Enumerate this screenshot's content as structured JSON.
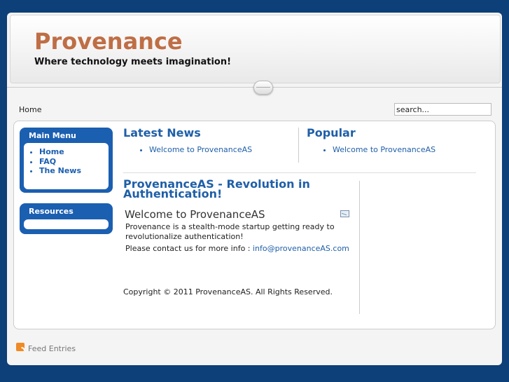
{
  "header": {
    "site_title": "Provenance",
    "slogan": "Where technology meets imagination!"
  },
  "breadcrumb": {
    "label": "Home"
  },
  "search": {
    "value": "search..."
  },
  "main_menu": {
    "title": "Main Menu",
    "items": [
      "Home",
      "FAQ",
      "The News"
    ]
  },
  "resources": {
    "title": "Resources"
  },
  "latest_news": {
    "title": "Latest News",
    "items": [
      "Welcome to ProvenanceAS"
    ]
  },
  "popular": {
    "title": "Popular",
    "items": [
      "Welcome to ProvenanceAS"
    ]
  },
  "article": {
    "title": "ProvenanceAS - Revolution in Authentication!",
    "heading": "Welcome to ProvenanceAS",
    "body": "Provenance is a stealth-mode startup getting ready to revolutionalize authentication!",
    "contact_prefix": "Please contact us for more info :",
    "contact_email": "info@provenanceAS.com"
  },
  "footer": {
    "copyright": "Copyright © 2011 ProvenanceAS. All Rights Reserved.",
    "feed_label": "Feed Entries"
  },
  "colors": {
    "background": "#0d3f78",
    "title": "#bf6e45",
    "link": "#1f5fa8",
    "module": "#1b5fb1"
  }
}
